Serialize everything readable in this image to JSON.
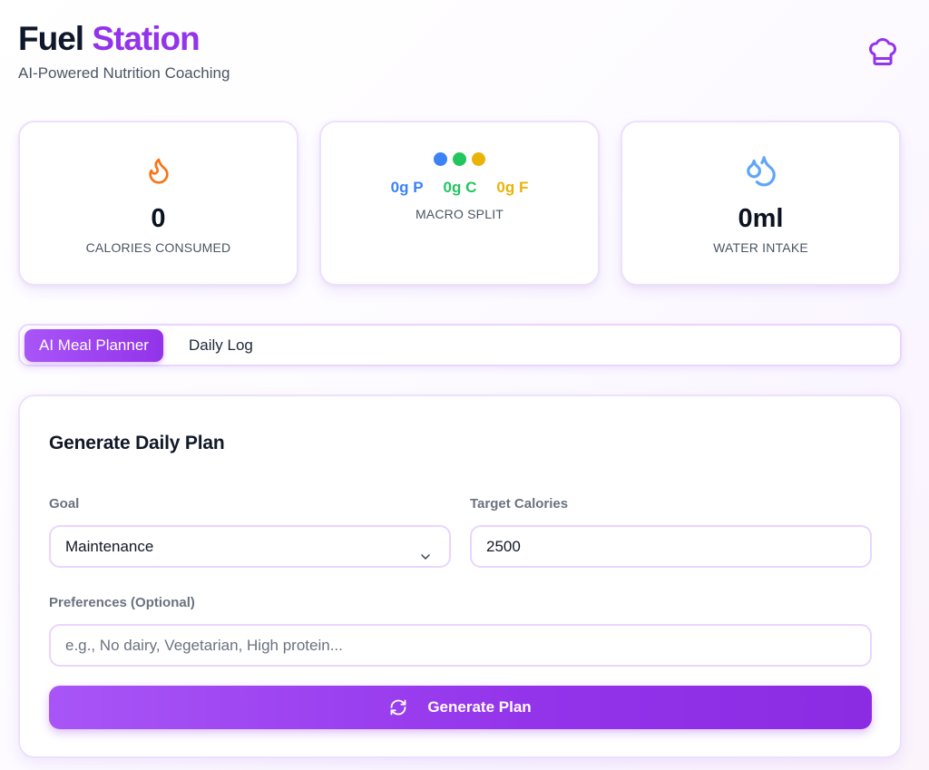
{
  "header": {
    "brand_part1": "Fuel",
    "brand_part2": "Station",
    "subtitle": "AI-Powered Nutrition Coaching",
    "icon": "chef-hat-icon"
  },
  "stats": {
    "calories": {
      "icon": "flame-icon",
      "value": "0",
      "label": "CALORIES CONSUMED"
    },
    "macros": {
      "dot_colors": [
        "#3b82f6",
        "#22c55e",
        "#eab308"
      ],
      "protein": "0g P",
      "carbs": "0g C",
      "fat": "0g F",
      "label": "MACRO SPLIT"
    },
    "water": {
      "icon": "droplets-icon",
      "value": "0ml",
      "label": "WATER INTAKE"
    }
  },
  "tabs": [
    {
      "label": "AI Meal Planner",
      "active": true
    },
    {
      "label": "Daily Log",
      "active": false
    }
  ],
  "form": {
    "title": "Generate Daily Plan",
    "goal_label": "Goal",
    "goal_value": "Maintenance",
    "calories_label": "Target Calories",
    "calories_value": "2500",
    "preferences_label": "Preferences (Optional)",
    "preferences_placeholder": "e.g., No dairy, Vegetarian, High protein...",
    "generate_label": "Generate Plan"
  },
  "colors": {
    "accent": "#9333ea",
    "protein": "#3b82f6",
    "carbs": "#22c55e",
    "fat": "#eab308",
    "flame": "#f97316",
    "water": "#60a5fa"
  }
}
